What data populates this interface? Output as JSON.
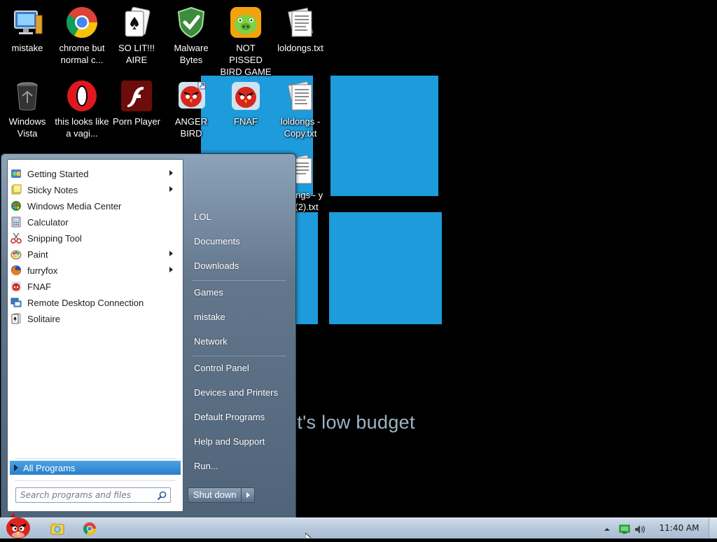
{
  "wallpaper": {
    "caption": "it's low budget",
    "tile_color": "#1E9BDB"
  },
  "desktop_icons": [
    {
      "label": "mistake",
      "icon": "computer-icon"
    },
    {
      "label": "chrome but normal c...",
      "icon": "chrome-icon"
    },
    {
      "label": "SO LIT!!! AIRE",
      "icon": "solitaire-icon"
    },
    {
      "label": "Malware Bytes",
      "icon": "shield-check-icon"
    },
    {
      "label": "NOT PISSED BIRD GAME",
      "icon": "pig-game-icon"
    },
    {
      "label": "loldongs.txt",
      "icon": "text-file-icon"
    },
    {
      "label": "Windows Vista",
      "icon": "recycle-bin-icon"
    },
    {
      "label": "this looks like a vagi...",
      "icon": "opera-icon"
    },
    {
      "label": "Porn Player",
      "icon": "flash-icon"
    },
    {
      "label": "ANGER BIRD",
      "icon": "angry-bird-shortcut-icon"
    },
    {
      "label": "FNAF",
      "icon": "angry-bird-icon"
    },
    {
      "label": "loldongs - Copy.txt",
      "icon": "text-file-icon"
    },
    {
      "label": "ongs - y (2).txt",
      "icon": "text-file-icon"
    }
  ],
  "start_menu": {
    "programs": [
      {
        "label": "Getting Started",
        "icon": "getting-started-icon",
        "has_submenu": true
      },
      {
        "label": "Sticky Notes",
        "icon": "sticky-notes-icon",
        "has_submenu": true
      },
      {
        "label": "Windows Media Center",
        "icon": "media-center-icon",
        "has_submenu": false
      },
      {
        "label": "Calculator",
        "icon": "calculator-icon",
        "has_submenu": false
      },
      {
        "label": "Snipping Tool",
        "icon": "scissors-icon",
        "has_submenu": false
      },
      {
        "label": "Paint",
        "icon": "paint-icon",
        "has_submenu": true
      },
      {
        "label": "furryfox",
        "icon": "firefox-icon",
        "has_submenu": true
      },
      {
        "label": "FNAF",
        "icon": "angry-bird-icon",
        "has_submenu": false
      },
      {
        "label": "Remote Desktop Connection",
        "icon": "remote-desktop-icon",
        "has_submenu": false
      },
      {
        "label": "Solitaire",
        "icon": "solitaire-icon",
        "has_submenu": false
      }
    ],
    "all_programs": "All Programs",
    "search_placeholder": "Search programs and files",
    "right_items": [
      "LOL",
      "Documents",
      "Downloads",
      "Games",
      "mistake",
      "Network",
      "Control Panel",
      "Devices and Printers",
      "Default Programs",
      "Help and Support",
      "Run..."
    ],
    "shutdown_label": "Shut down"
  },
  "taskbar": {
    "start_icon": "angry-bird-start-icon",
    "pinned": [
      "explorer-folder-icon",
      "chrome-icon"
    ],
    "clock": "11:40 AM",
    "tray_icons": [
      "show-hidden-icons-icon",
      "network-icon",
      "volume-icon"
    ]
  },
  "colors": {
    "accent": "#2A7FC9",
    "taskbar": "#B6C8DB"
  }
}
